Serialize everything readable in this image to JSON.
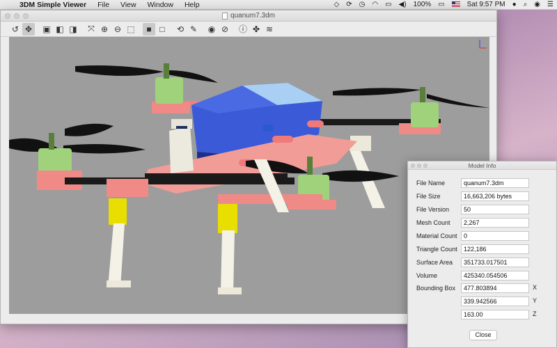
{
  "menubar": {
    "app_name": "3DM Simple Viewer",
    "items": [
      "File",
      "View",
      "Window",
      "Help"
    ],
    "battery": "100%",
    "clock": "Sat 9:57 PM"
  },
  "window": {
    "title": "quanum7.3dm"
  },
  "model_info": {
    "title": "Model Info",
    "rows": [
      {
        "label": "File Name",
        "value": "quanum7.3dm"
      },
      {
        "label": "File Size",
        "value": "16,663,206 bytes"
      },
      {
        "label": "File Version",
        "value": "50"
      },
      {
        "label": "Mesh Count",
        "value": "2,267"
      },
      {
        "label": "Material Count",
        "value": "0"
      },
      {
        "label": "Triangle Count",
        "value": "122,186"
      },
      {
        "label": "Surface Area",
        "value": "351733.017501"
      },
      {
        "label": "Volume",
        "value": "425340.054506"
      }
    ],
    "bounding_box": {
      "label": "Bounding Box",
      "x": "477.803894",
      "x_label": "X",
      "y": "339.942566",
      "y_label": "Y",
      "z": "163.00",
      "z_label": "Z"
    },
    "close_label": "Close"
  }
}
